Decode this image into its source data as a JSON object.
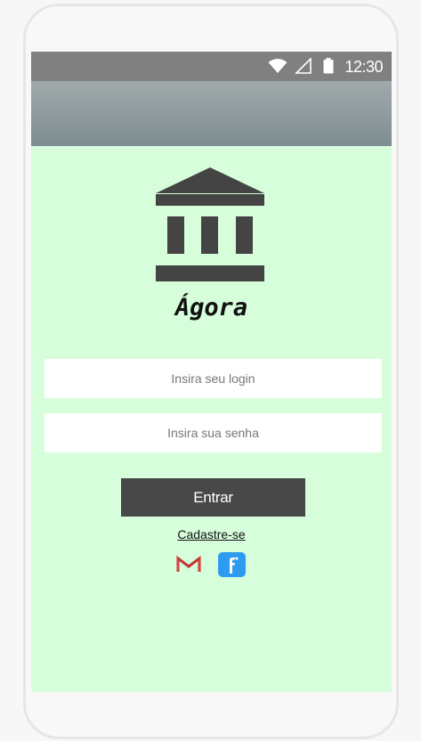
{
  "status_bar": {
    "time": "12:30",
    "icons": [
      "wifi-icon",
      "signal-icon",
      "battery-icon"
    ],
    "background": "#808080"
  },
  "app": {
    "name": "Ágora",
    "logo_icon": "bank-building-icon",
    "background": "#d6fedb"
  },
  "form": {
    "login_placeholder": "Insira seu login",
    "password_placeholder": "Insira sua senha",
    "submit_label": "Entrar",
    "register_link": "Cadastre-se"
  },
  "social": [
    {
      "icon": "gmail-icon"
    },
    {
      "icon": "facebook-icon"
    }
  ]
}
